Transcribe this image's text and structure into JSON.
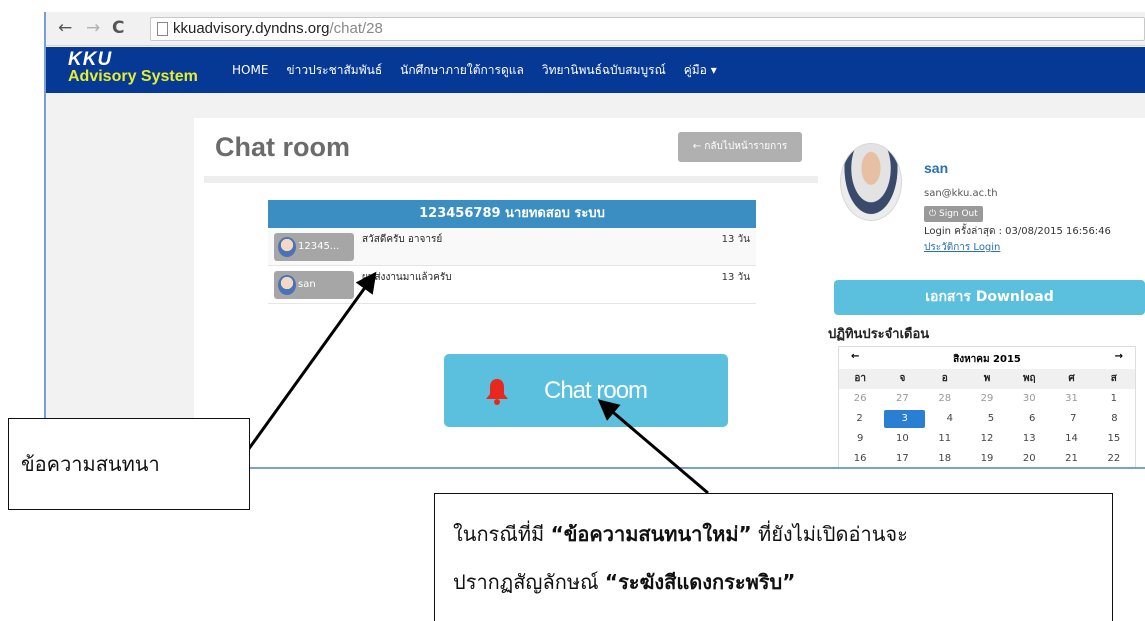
{
  "browser": {
    "url_host": "kkuadvisory.dyndns.org",
    "url_path": "/chat/28"
  },
  "navbar": {
    "brand_top": "KKU",
    "brand_bottom": "Advisory System",
    "items": [
      {
        "label": "HOME"
      },
      {
        "label": "ข่าวประชาสัมพันธ์"
      },
      {
        "label": "นักศึกษาภายใต้การดูแล"
      },
      {
        "label": "วิทยานิพนธ์ฉบับสมบูรณ์"
      },
      {
        "label": "คู่มือ ▾"
      }
    ]
  },
  "main": {
    "title": "Chat room",
    "back_button": "← กลับไปหน้ารายการ",
    "chat_header": "123456789 นายทดสอบ ระบบ",
    "messages": [
      {
        "sender": "12345...",
        "text": "สวัสดีครับ อาจารย์",
        "time": "13 วัน"
      },
      {
        "sender": "san",
        "text": "ผมส่งงานมาแล้วครับ",
        "time": "13 วัน"
      }
    ],
    "chat_button": "Chat room",
    "bell_color": "#e8281e"
  },
  "sidebar": {
    "name": "san",
    "email": "san@kku.ac.th",
    "signout": "⏻ Sign Out",
    "last_login": "Login ครั้งล่าสุด : 03/08/2015 16:56:46",
    "login_history": "ประวัติการ Login",
    "download_button": "เอกสาร Download",
    "calendar_heading": "ปฏิทินประจำเดือน",
    "calendar": {
      "prev": "←",
      "month": "สิงหาคม 2015",
      "next": "→",
      "dow": [
        "อา",
        "จ",
        "อ",
        "พ",
        "พฤ",
        "ศ",
        "ส"
      ],
      "weeks": [
        [
          "26",
          "27",
          "28",
          "29",
          "30",
          "31",
          "1"
        ],
        [
          "2",
          "3",
          "4",
          "5",
          "6",
          "7",
          "8"
        ],
        [
          "9",
          "10",
          "11",
          "12",
          "13",
          "14",
          "15"
        ],
        [
          "16",
          "17",
          "18",
          "19",
          "20",
          "21",
          "22"
        ]
      ],
      "today": "3"
    }
  },
  "annotations": {
    "left_label": "ข้อความสนทนา",
    "right_prefix": "ในกรณีที่มี ",
    "right_bold1": "“ข้อความสนทนาใหม่”",
    "right_mid": " ที่ยังไม่เปิดอ่านจะ",
    "right_line2": "ปรากฏสัญลักษณ์ ",
    "right_bold2": "“ระฆังสีแดงกระพริบ”"
  }
}
